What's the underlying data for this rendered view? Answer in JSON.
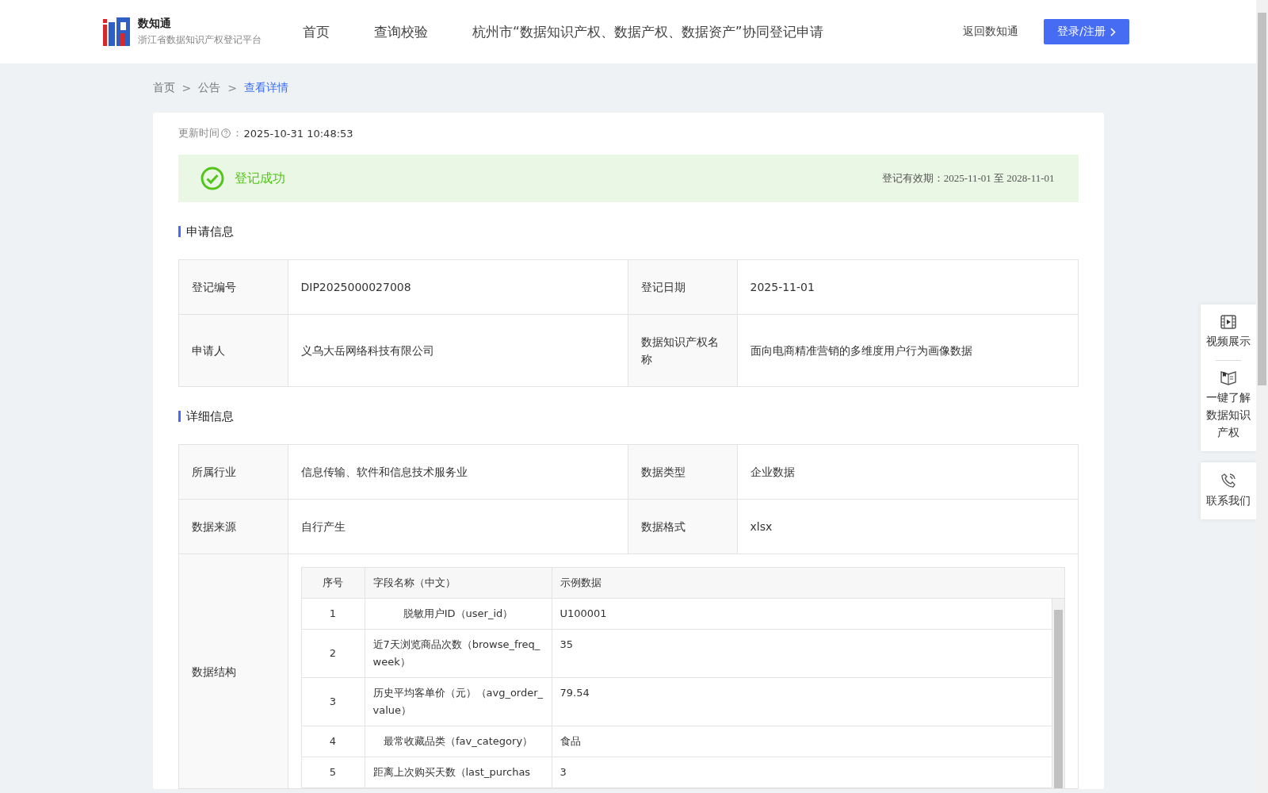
{
  "header": {
    "logo": {
      "title": "数知通",
      "subtitle": "浙江省数据知识产权登记平台"
    },
    "nav": [
      "首页",
      "查询校验",
      "杭州市“数据知识产权、数据产权、数据资产”协同登记申请"
    ],
    "back_link": "返回数知通",
    "login_button": "登录/注册"
  },
  "breadcrumb": [
    {
      "label": "首页",
      "current": false
    },
    {
      "label": "公告",
      "current": false
    },
    {
      "label": "查看详情",
      "current": true
    }
  ],
  "breadcrumb_separator": ">",
  "update": {
    "label": "更新时间",
    "colon": "：",
    "value": "2025-10-31 10:48:53"
  },
  "status": {
    "label": "登记成功",
    "validity_label": "登记有效期：",
    "validity_value": "2025-11-01 至 2028-11-01"
  },
  "application_info": {
    "title": "申请信息",
    "rows": [
      [
        {
          "label": "登记编号",
          "value": "DIP2025000027008"
        },
        {
          "label": "登记日期",
          "value": "2025-11-01"
        }
      ],
      [
        {
          "label": "申请人",
          "value": "义乌大岳网络科技有限公司"
        },
        {
          "label": "数据知识产权名称",
          "value": "面向电商精准营销的多维度用户行为画像数据"
        }
      ]
    ]
  },
  "detail_info": {
    "title": "详细信息",
    "rows": [
      [
        {
          "label": "所属行业",
          "value": "信息传输、软件和信息技术服务业"
        },
        {
          "label": "数据类型",
          "value": "企业数据"
        }
      ],
      [
        {
          "label": "数据来源",
          "value": "自行产生"
        },
        {
          "label": "数据格式",
          "value": "xlsx"
        }
      ]
    ],
    "structure": {
      "label": "数据结构",
      "columns": [
        "序号",
        "字段名称（中文）",
        "示例数据"
      ],
      "rows": [
        [
          "1",
          "脱敏用户ID（user_id）",
          "U100001"
        ],
        [
          "2",
          "近7天浏览商品次数（browse_freq_week）",
          "35"
        ],
        [
          "3",
          "历史平均客单价（元）（avg_order_value）",
          "79.54"
        ],
        [
          "4",
          "最常收藏品类（fav_category）",
          "食品"
        ],
        [
          "5",
          "距离上次购买天数（last_purchas",
          "3"
        ]
      ]
    }
  },
  "side_panel": [
    [
      {
        "kind": "video",
        "label": "视频展示"
      },
      {
        "kind": "book",
        "label": "一键了解数据知识产权"
      }
    ],
    [
      {
        "kind": "phone",
        "label": "联系我们"
      }
    ]
  ]
}
